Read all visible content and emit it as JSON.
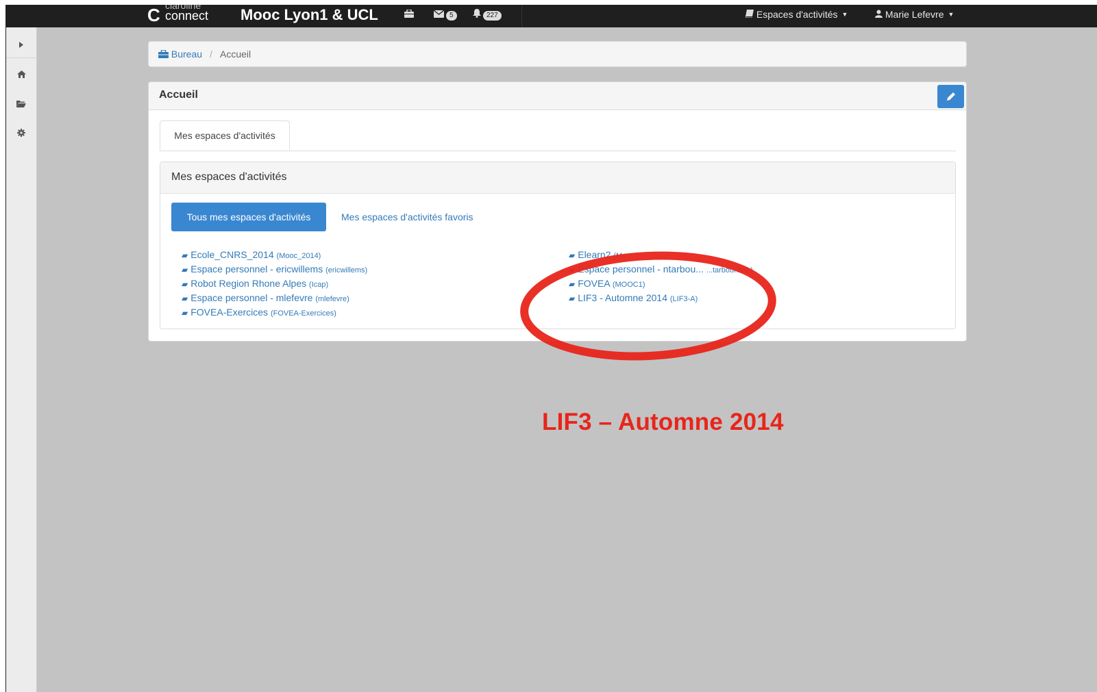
{
  "navbar": {
    "logo_top": "claroline",
    "logo_bottom": "connect",
    "title": "Mooc Lyon1 & UCL",
    "messages_count": "5",
    "notifications_count": "227",
    "workspaces_menu": "Espaces d'activités",
    "user_menu": "Marie Lefevre"
  },
  "breadcrumb": {
    "home": "Bureau",
    "separator": "/",
    "current": "Accueil"
  },
  "panel": {
    "title": "Accueil",
    "tab": "Mes espaces d'activités"
  },
  "workspaces": {
    "title": "Mes espaces d'activités",
    "all_button": "Tous mes espaces d'activités",
    "favorites_link": "Mes espaces d'activités favoris",
    "left": [
      {
        "name": "Ecole_CNRS_2014",
        "code": "(Mooc_2014)"
      },
      {
        "name": "Espace personnel - ericwillems",
        "code": "(ericwillems)"
      },
      {
        "name": "Robot Region Rhone Alpes",
        "code": "(Icap)"
      },
      {
        "name": "Espace personnel - mlefevre",
        "code": "(mlefevre)"
      },
      {
        "name": "FOVEA-Exercices",
        "code": "(FOVEA-Exercices)"
      }
    ],
    "right": [
      {
        "name": "Elearn2",
        "code": "(Mo..."
      },
      {
        "name": "Espace personnel - ntarbou...",
        "code": "...tarbouriech)"
      },
      {
        "name": "FOVEA",
        "code": "(MOOC1)"
      },
      {
        "name": "LIF3 - Automne 2014",
        "code": "(LIF3-A)"
      }
    ]
  },
  "annotation": {
    "text": "LIF3 – Automne 2014",
    "color": "#e8251b"
  },
  "icons": [
    "book-icon",
    "briefcase-icon",
    "envelope-icon",
    "bell-icon",
    "home-icon",
    "folder-icon",
    "gear-icon",
    "pencil-icon",
    "user-icon"
  ]
}
